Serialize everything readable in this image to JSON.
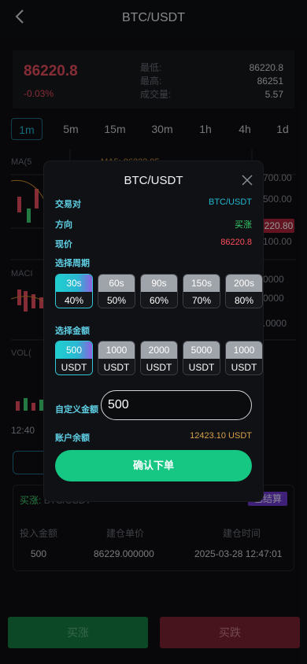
{
  "header": {
    "title": "BTC/USDT"
  },
  "ticker": {
    "price": "86220.8",
    "change": "-0.03%",
    "stats": [
      {
        "label": "最低:",
        "value": "86220.8"
      },
      {
        "label": "最高:",
        "value": "86251"
      },
      {
        "label": "成交量:",
        "value": "5.57"
      }
    ]
  },
  "periods": [
    "1m",
    "5m",
    "15m",
    "30m",
    "1h",
    "4h",
    "1d"
  ],
  "chart_bg": {
    "axis_right": [
      "700.00",
      "500.00",
      "220.80",
      "100.00",
      "0000",
      "0000",
      ".0000"
    ],
    "left_labels": [
      "MA(5",
      "MACI",
      "VOL(",
      "12:40"
    ],
    "ma_label": "MA5: 86232.95"
  },
  "orders": {
    "status": "买涨:",
    "status_rest": "BTC/USDT",
    "settle_label": "已结算",
    "headers": [
      "投入金额",
      "建仓单价",
      "建仓时间"
    ],
    "row": [
      "500",
      "86229.000000",
      "2025-03-28 12:47:01"
    ]
  },
  "buttons": {
    "buy": "买涨",
    "sell": "买跌"
  },
  "modal": {
    "title": "BTC/USDT",
    "pair_label": "交易对",
    "pair_value": "BTC/USDT",
    "direction_label": "方向",
    "direction_value": "买涨",
    "price_label": "现价",
    "price_value": "86220.8",
    "period_label": "选择周期",
    "period_options": [
      {
        "time": "30s",
        "rate": "40%",
        "selected": true
      },
      {
        "time": "60s",
        "rate": "50%",
        "selected": false
      },
      {
        "time": "90s",
        "rate": "60%",
        "selected": false
      },
      {
        "time": "150s",
        "rate": "70%",
        "selected": false
      },
      {
        "time": "200s",
        "rate": "80%",
        "selected": false
      }
    ],
    "amount_label": "选择金额",
    "amount_options": [
      {
        "amount": "500",
        "unit": "USDT",
        "selected": true
      },
      {
        "amount": "1000",
        "unit": "USDT",
        "selected": false
      },
      {
        "amount": "2000",
        "unit": "USDT",
        "selected": false
      },
      {
        "amount": "5000",
        "unit": "USDT",
        "selected": false
      },
      {
        "amount": "1000",
        "unit": "USDT",
        "selected": false
      }
    ],
    "custom_label": "自定义金额",
    "custom_value": "500",
    "balance_label": "账户余额",
    "balance_value": "12423.10 USDT",
    "confirm_label": "确认下单"
  }
}
